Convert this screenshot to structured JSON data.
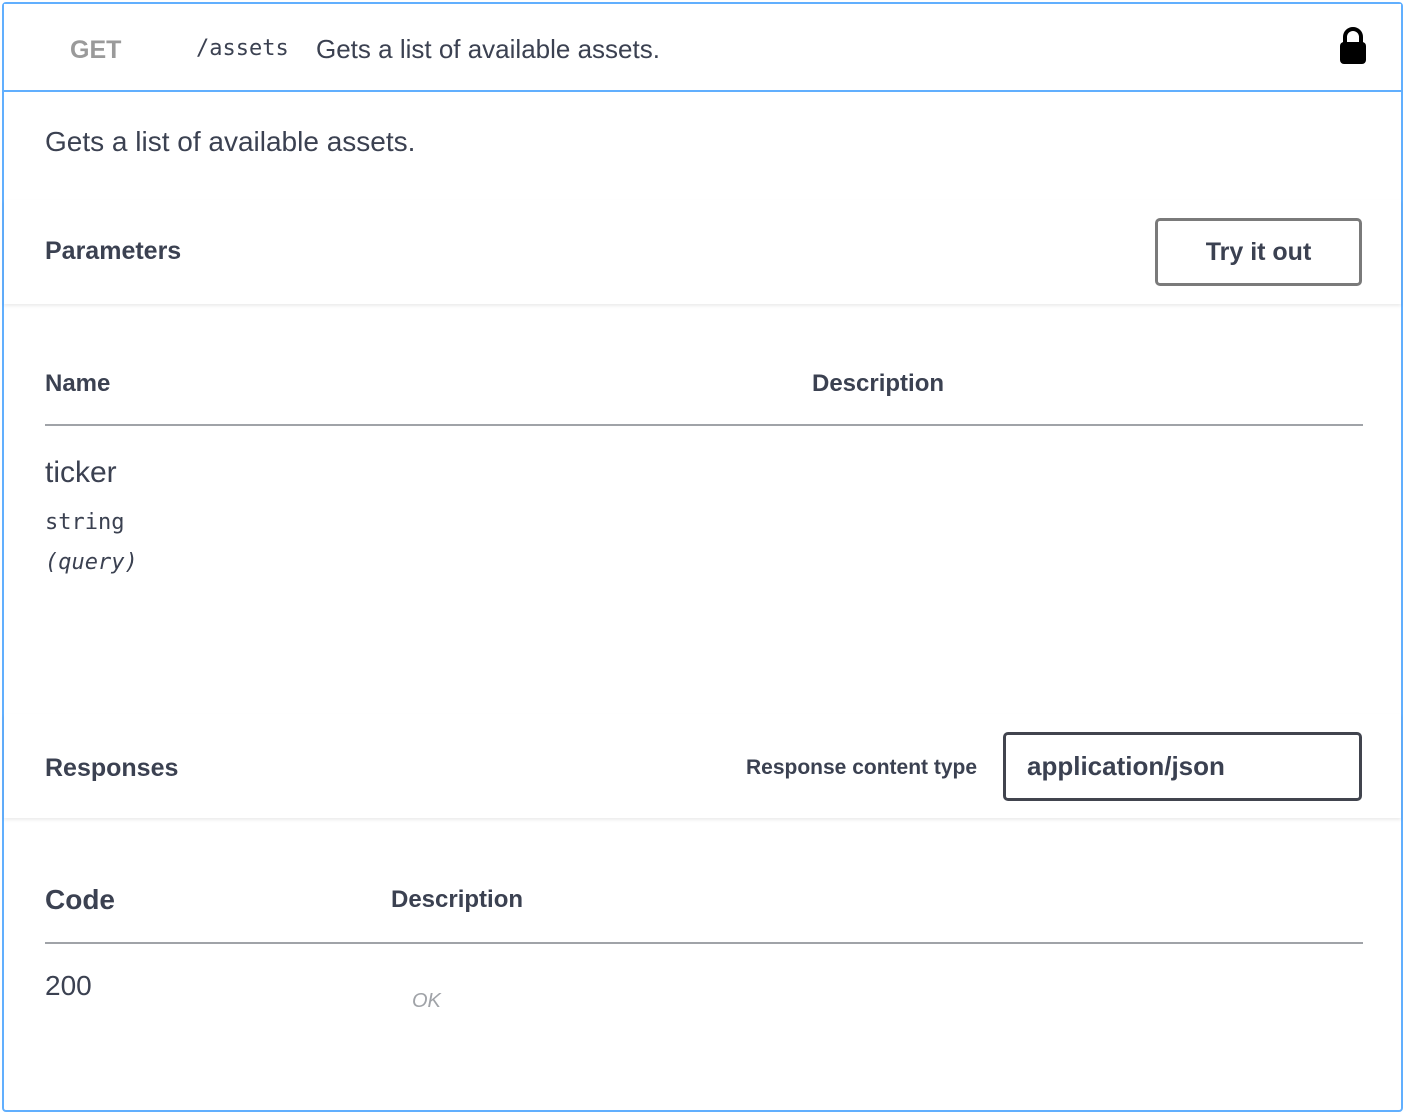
{
  "summary": {
    "method": "GET",
    "path": "/assets",
    "description": "Gets a list of available assets."
  },
  "description": "Gets a list of available assets.",
  "parameters": {
    "title": "Parameters",
    "try_button": "Try it out",
    "columns": [
      "Name",
      "Description"
    ],
    "items": [
      {
        "name": "ticker",
        "type": "string",
        "in": "(query)"
      }
    ]
  },
  "responses": {
    "title": "Responses",
    "content_type_label": "Response content type",
    "content_type_value": "application/json",
    "columns": [
      "Code",
      "Description"
    ],
    "items": [
      {
        "code": "200",
        "description": "OK"
      }
    ]
  },
  "icons": {
    "lock": "lock-icon"
  },
  "colors": {
    "get_border": "#61affe",
    "text": "#3b4151"
  }
}
